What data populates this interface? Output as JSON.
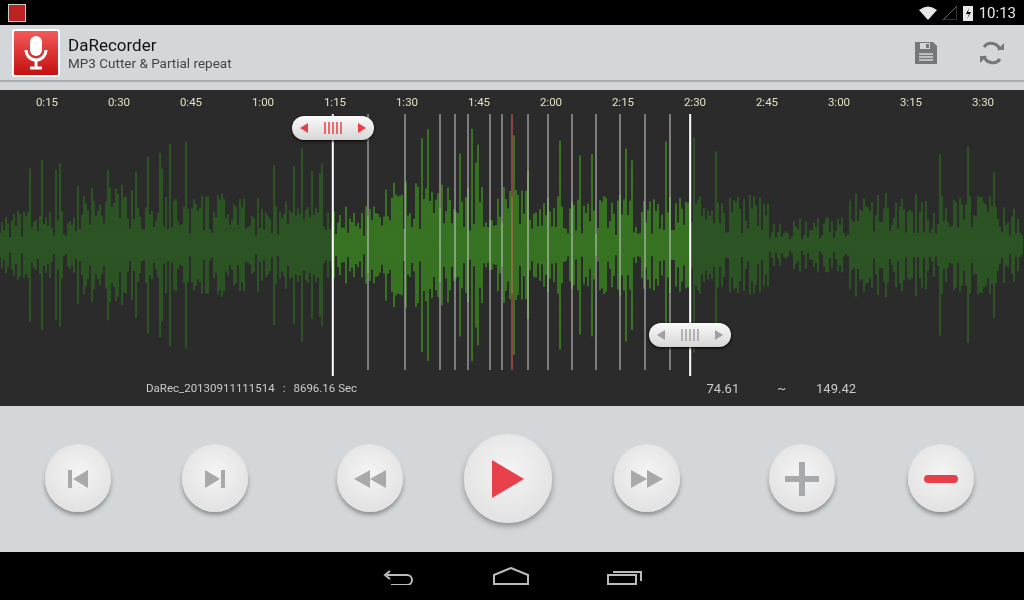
{
  "status_bar": {
    "time": "10:13"
  },
  "action_bar": {
    "title": "DaRecorder",
    "subtitle": "MP3 Cutter & Partial repeat"
  },
  "timeline": {
    "labels": [
      "0:15",
      "0:30",
      "0:45",
      "1:00",
      "1:15",
      "1:30",
      "1:45",
      "2:00",
      "2:15",
      "2:30",
      "2:45",
      "3:00",
      "3:15",
      "3:30"
    ]
  },
  "handles": [
    {
      "kind": "start",
      "level": 0.325,
      "selected": true
    },
    {
      "kind": "end",
      "level": 0.674,
      "selected": false
    }
  ],
  "info": {
    "file_name": "DaRec_20130911111514",
    "separator": ":",
    "duration": "8696.16 Sec",
    "range_start": "74.61",
    "range_tilde": "~",
    "range_end": "149.42"
  },
  "controls": [
    {
      "kind": "skip-previous"
    },
    {
      "kind": "skip-next"
    },
    {
      "kind": "rewind"
    },
    {
      "kind": "play"
    },
    {
      "kind": "fast-forward"
    },
    {
      "kind": "plus"
    },
    {
      "kind": "minus"
    }
  ]
}
